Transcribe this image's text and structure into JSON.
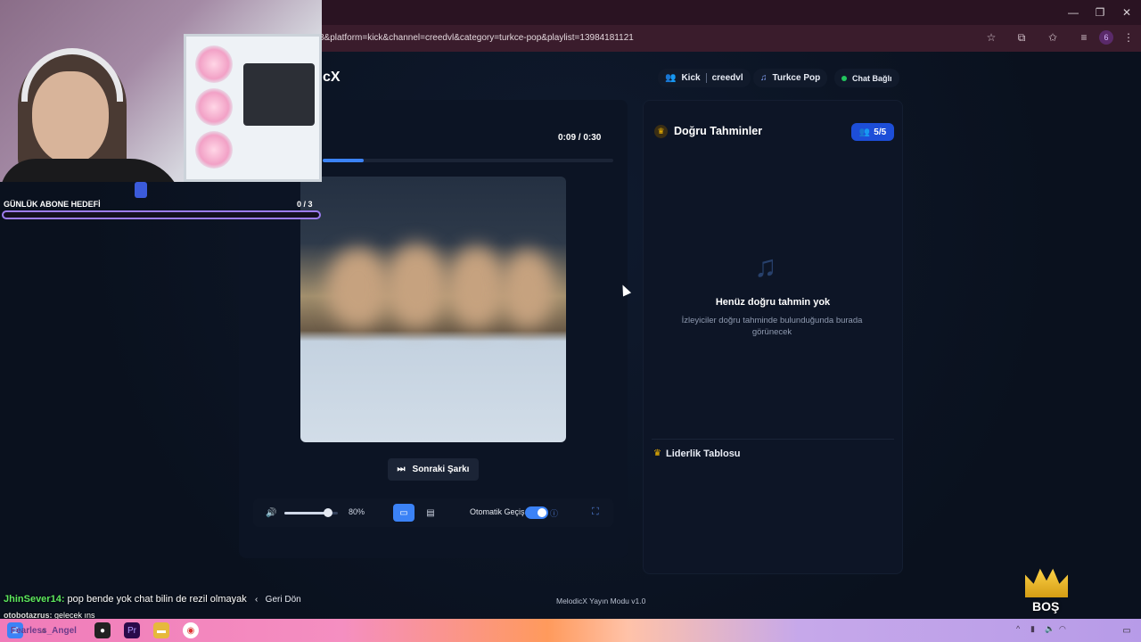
{
  "browser": {
    "url": "8&platform=kick&channel=creedvl&category=turkce-pop&playlist=13984181121",
    "profile_initial": "6"
  },
  "app": {
    "logo": "cX",
    "platform_pill": {
      "platform": "Kick",
      "channel": "creedvl"
    },
    "category_pill": "Turkce Pop",
    "chat_status": "Chat Bağlı",
    "player": {
      "time": "0:09 / 0:30",
      "progress_fraction": 0.3,
      "next_button": "Sonraki Şarkı",
      "volume_label": "80%",
      "volume_fraction": 0.8,
      "auto_switch_label": "Otomatik Geçiş",
      "auto_switch_on": true
    },
    "guesses": {
      "title": "Doğru Tahminler",
      "count": "5/5",
      "empty_title": "Henüz doğru tahmin yok",
      "empty_subtitle": "İzleyiciler doğru tahminde bulunduğunda burada görünecek",
      "leaderboard_title": "Liderlik Tablosu"
    },
    "back_button": "Geri Dön",
    "version": "MelodicX Yayın Modu v1.0"
  },
  "overlay": {
    "goal_label": "GÜNLÜK ABONE HEDEFİ",
    "goal_count": "0 / 3",
    "chat": [
      {
        "user": "JhinSever14:",
        "message": " pop bende yok chat bilin de rezil olmayak"
      },
      {
        "user": "otobotazrus:",
        "message": " gelecek ıns"
      },
      {
        "user": "Fearless_Angel",
        "message": ""
      }
    ],
    "badge_text": "BOŞ"
  },
  "colors": {
    "accent": "#3b82f6",
    "success": "#22c55e",
    "crown": "#f5b800"
  }
}
